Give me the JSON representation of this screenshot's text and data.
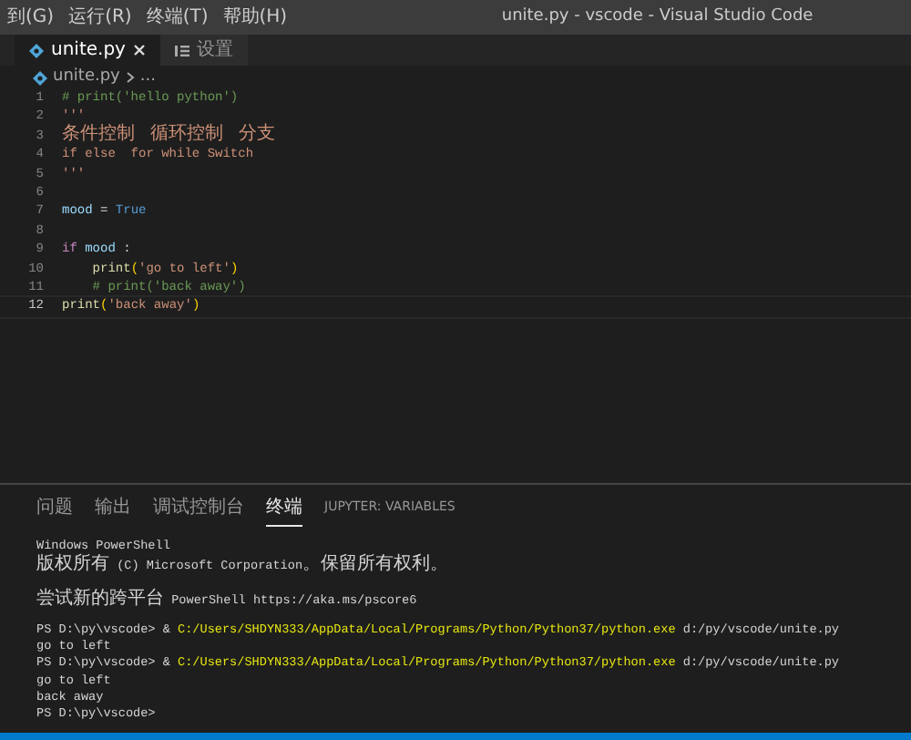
{
  "menu": [
    "到(G)",
    "运行(R)",
    "终端(T)",
    "帮助(H)"
  ],
  "window": {
    "title": "unite.py - vscode - Visual Studio Code"
  },
  "tabs": [
    {
      "label": "unite.py",
      "kind": "python",
      "selected": true
    },
    {
      "label": "设置",
      "kind": "settings",
      "selected": false
    }
  ],
  "breadcrumb": [
    "unite.py",
    "..."
  ],
  "code": {
    "lines": [
      {
        "number": "1",
        "current": false,
        "tokens": [
          {
            "kind": "comment",
            "text": "# print('hello python')"
          }
        ]
      },
      {
        "number": "2",
        "current": false,
        "tokens": [
          {
            "kind": "string",
            "text": "'''"
          }
        ]
      },
      {
        "number": "3",
        "current": false,
        "tokens": [
          {
            "kind": "string",
            "text": "条件控制  循环控制  分支"
          }
        ]
      },
      {
        "number": "4",
        "current": false,
        "tokens": [
          {
            "kind": "string",
            "text": "if else  for while Switch"
          }
        ]
      },
      {
        "number": "5",
        "current": false,
        "tokens": [
          {
            "kind": "string",
            "text": "'''"
          }
        ]
      },
      {
        "number": "6",
        "current": false
      },
      {
        "number": "7",
        "current": false,
        "tokens": [
          {
            "kind": "variable",
            "text": "mood"
          },
          {
            "kind": "plain",
            "text": " = "
          },
          {
            "kind": "constant",
            "text": "True"
          }
        ]
      },
      {
        "number": "8",
        "current": false
      },
      {
        "number": "9",
        "current": false,
        "tokens": [
          {
            "kind": "keyword",
            "text": "if"
          },
          {
            "kind": "variable",
            "text": " mood"
          },
          {
            "kind": "plain",
            "text": " :"
          }
        ]
      },
      {
        "number": "10",
        "current": false,
        "tokens": [
          {
            "kind": "function",
            "text": "    print"
          },
          {
            "kind": "paren",
            "text": "("
          },
          {
            "kind": "string",
            "text": "'go to left'"
          },
          {
            "kind": "paren",
            "text": ")"
          }
        ]
      },
      {
        "number": "11",
        "current": false,
        "tokens": [
          {
            "kind": "comment",
            "text": "    # print('back away')"
          }
        ]
      },
      {
        "number": "12",
        "current": true,
        "tokens": [
          {
            "kind": "function",
            "text": "print"
          },
          {
            "kind": "paren",
            "text": "("
          },
          {
            "kind": "string",
            "text": "'back away'"
          },
          {
            "kind": "paren",
            "text": ")"
          }
        ]
      }
    ]
  },
  "panel": {
    "tabs": [
      {
        "label": "问题",
        "selected": false
      },
      {
        "label": "输出",
        "selected": false
      },
      {
        "label": "调试控制台",
        "selected": false
      },
      {
        "label": "终端",
        "selected": true
      },
      {
        "label": "JUPYTER: VARIABLES",
        "selected": false
      }
    ],
    "terminal": [
      {
        "kind": "text",
        "segments": [
          {
            "kind": "plain",
            "text": "Windows PowerShell"
          }
        ]
      },
      {
        "kind": "text",
        "segments": [
          {
            "kind": "plain",
            "text": "版权所有 (C) Microsoft Corporation。保留所有权利。"
          }
        ]
      },
      {
        "kind": "blank"
      },
      {
        "kind": "text",
        "segments": [
          {
            "kind": "plain",
            "text": "尝试新的跨平台 PowerShell https://aka.ms/pscore6"
          }
        ]
      },
      {
        "kind": "blank"
      },
      {
        "kind": "text",
        "segments": [
          {
            "kind": "plain",
            "text": "PS D:\\py\\vscode> & "
          },
          {
            "kind": "path",
            "text": "C:/Users/SHDYN333/AppData/Local/Programs/Python/Python37/python.exe"
          },
          {
            "kind": "plain",
            "text": " d:/py/vscode/unite.py"
          }
        ]
      },
      {
        "kind": "text",
        "segments": [
          {
            "kind": "plain",
            "text": "go to left"
          }
        ]
      },
      {
        "kind": "text",
        "segments": [
          {
            "kind": "plain",
            "text": "PS D:\\py\\vscode> & "
          },
          {
            "kind": "path",
            "text": "C:/Users/SHDYN333/AppData/Local/Programs/Python/Python37/python.exe"
          },
          {
            "kind": "plain",
            "text": " d:/py/vscode/unite.py"
          }
        ]
      },
      {
        "kind": "text",
        "segments": [
          {
            "kind": "plain",
            "text": "go to left"
          }
        ]
      },
      {
        "kind": "text",
        "segments": [
          {
            "kind": "plain",
            "text": "back away"
          }
        ]
      },
      {
        "kind": "text",
        "segments": [
          {
            "kind": "plain",
            "text": "PS D:\\py\\vscode>"
          }
        ]
      }
    ]
  }
}
